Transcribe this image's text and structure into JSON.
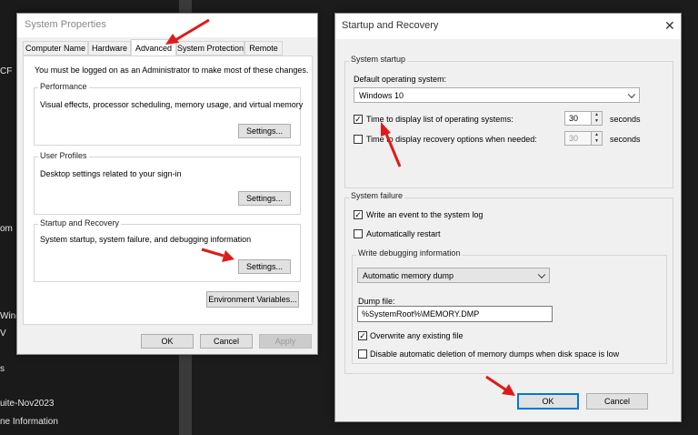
{
  "background": {
    "texts": [
      "CF",
      "om",
      "Wind",
      "V",
      "s",
      "uite-Nov2023",
      "ne Information"
    ]
  },
  "sysprops": {
    "title": "System Properties",
    "tabs": [
      "Computer Name",
      "Hardware",
      "Advanced",
      "System Protection",
      "Remote"
    ],
    "active_tab": "Advanced",
    "admin_note": "You must be logged on as an Administrator to make most of these changes.",
    "performance": {
      "label": "Performance",
      "desc": "Visual effects, processor scheduling, memory usage, and virtual memory",
      "button": "Settings..."
    },
    "user_profiles": {
      "label": "User Profiles",
      "desc": "Desktop settings related to your sign-in",
      "button": "Settings..."
    },
    "startup_recovery": {
      "label": "Startup and Recovery",
      "desc": "System startup, system failure, and debugging information",
      "button": "Settings..."
    },
    "env_button": "Environment Variables...",
    "ok": "OK",
    "cancel": "Cancel",
    "apply": "Apply"
  },
  "startup": {
    "title": "Startup and Recovery",
    "close": "✕",
    "system_startup": {
      "label": "System startup",
      "default_os_label": "Default operating system:",
      "default_os": "Windows 10",
      "time_list_label": "Time to display list of operating systems:",
      "time_list_checked": true,
      "time_list_value": "30",
      "time_recovery_label": "Time to display recovery options when needed:",
      "time_recovery_checked": false,
      "time_recovery_value": "30",
      "seconds": "seconds"
    },
    "system_failure": {
      "label": "System failure",
      "write_event": "Write an event to the system log",
      "write_event_checked": true,
      "auto_restart": "Automatically restart",
      "auto_restart_checked": false,
      "debug_label": "Write debugging information",
      "debug_option": "Automatic memory dump",
      "dump_file_label": "Dump file:",
      "dump_file": "%SystemRoot%\\MEMORY.DMP",
      "overwrite": "Overwrite any existing file",
      "overwrite_checked": true,
      "disable_auto_delete": "Disable automatic deletion of memory dumps when disk space is low",
      "disable_auto_delete_checked": false
    },
    "ok": "OK",
    "cancel": "Cancel"
  },
  "annotation_color": "#e01a1a"
}
